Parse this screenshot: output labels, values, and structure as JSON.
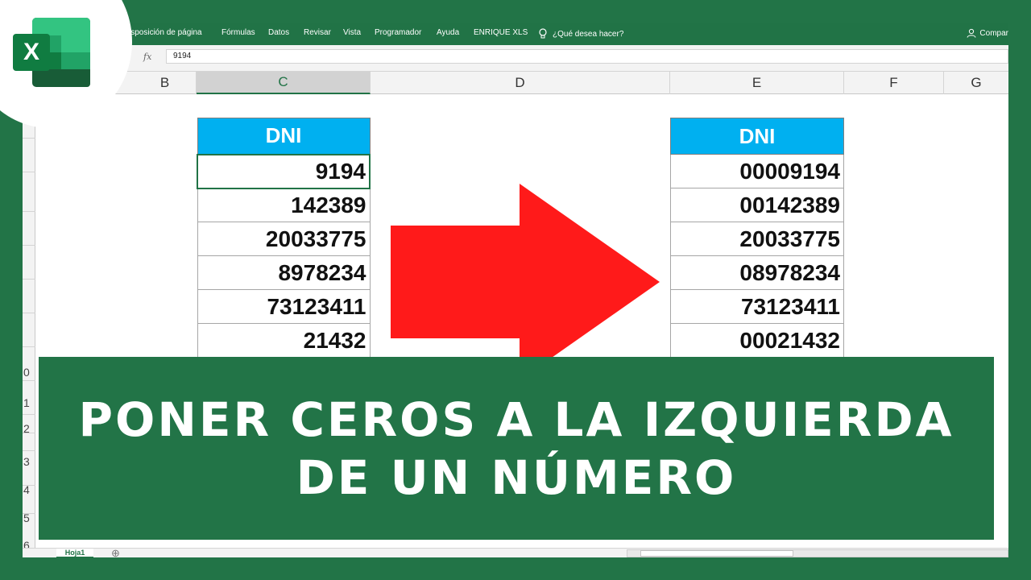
{
  "ribbon": {
    "tabs": [
      "isposición de página",
      "Fórmulas",
      "Datos",
      "Revisar",
      "Vista",
      "Programador",
      "Ayuda",
      "ENRIQUE XLS"
    ],
    "search_label": "¿Qué desea hacer?",
    "share_label": "Compar"
  },
  "formula_bar": {
    "fx_label": "fx",
    "value": "9194"
  },
  "columns": [
    "B",
    "C",
    "D",
    "E",
    "F",
    "G"
  ],
  "row_numbers": [
    "0",
    "1",
    "2",
    "3",
    "4",
    "5",
    "6"
  ],
  "left_table": {
    "header": "DNI",
    "values": [
      "9194",
      "142389",
      "20033775",
      "8978234",
      "73123411",
      "21432"
    ]
  },
  "right_table": {
    "header": "DNI",
    "values": [
      "00009194",
      "00142389",
      "20033775",
      "08978234",
      "73123411",
      "00021432"
    ]
  },
  "banner": {
    "line1": "PONER CEROS A LA IZQUIERDA",
    "line2": "DE UN NÚMERO"
  },
  "logo": {
    "letter": "X"
  },
  "sheet": {
    "tab_label": "Hoja1",
    "add_label": "⊕"
  },
  "colors": {
    "excel_green": "#217346",
    "header_cyan": "#00b0f0",
    "arrow_red": "#ff1a1a"
  }
}
